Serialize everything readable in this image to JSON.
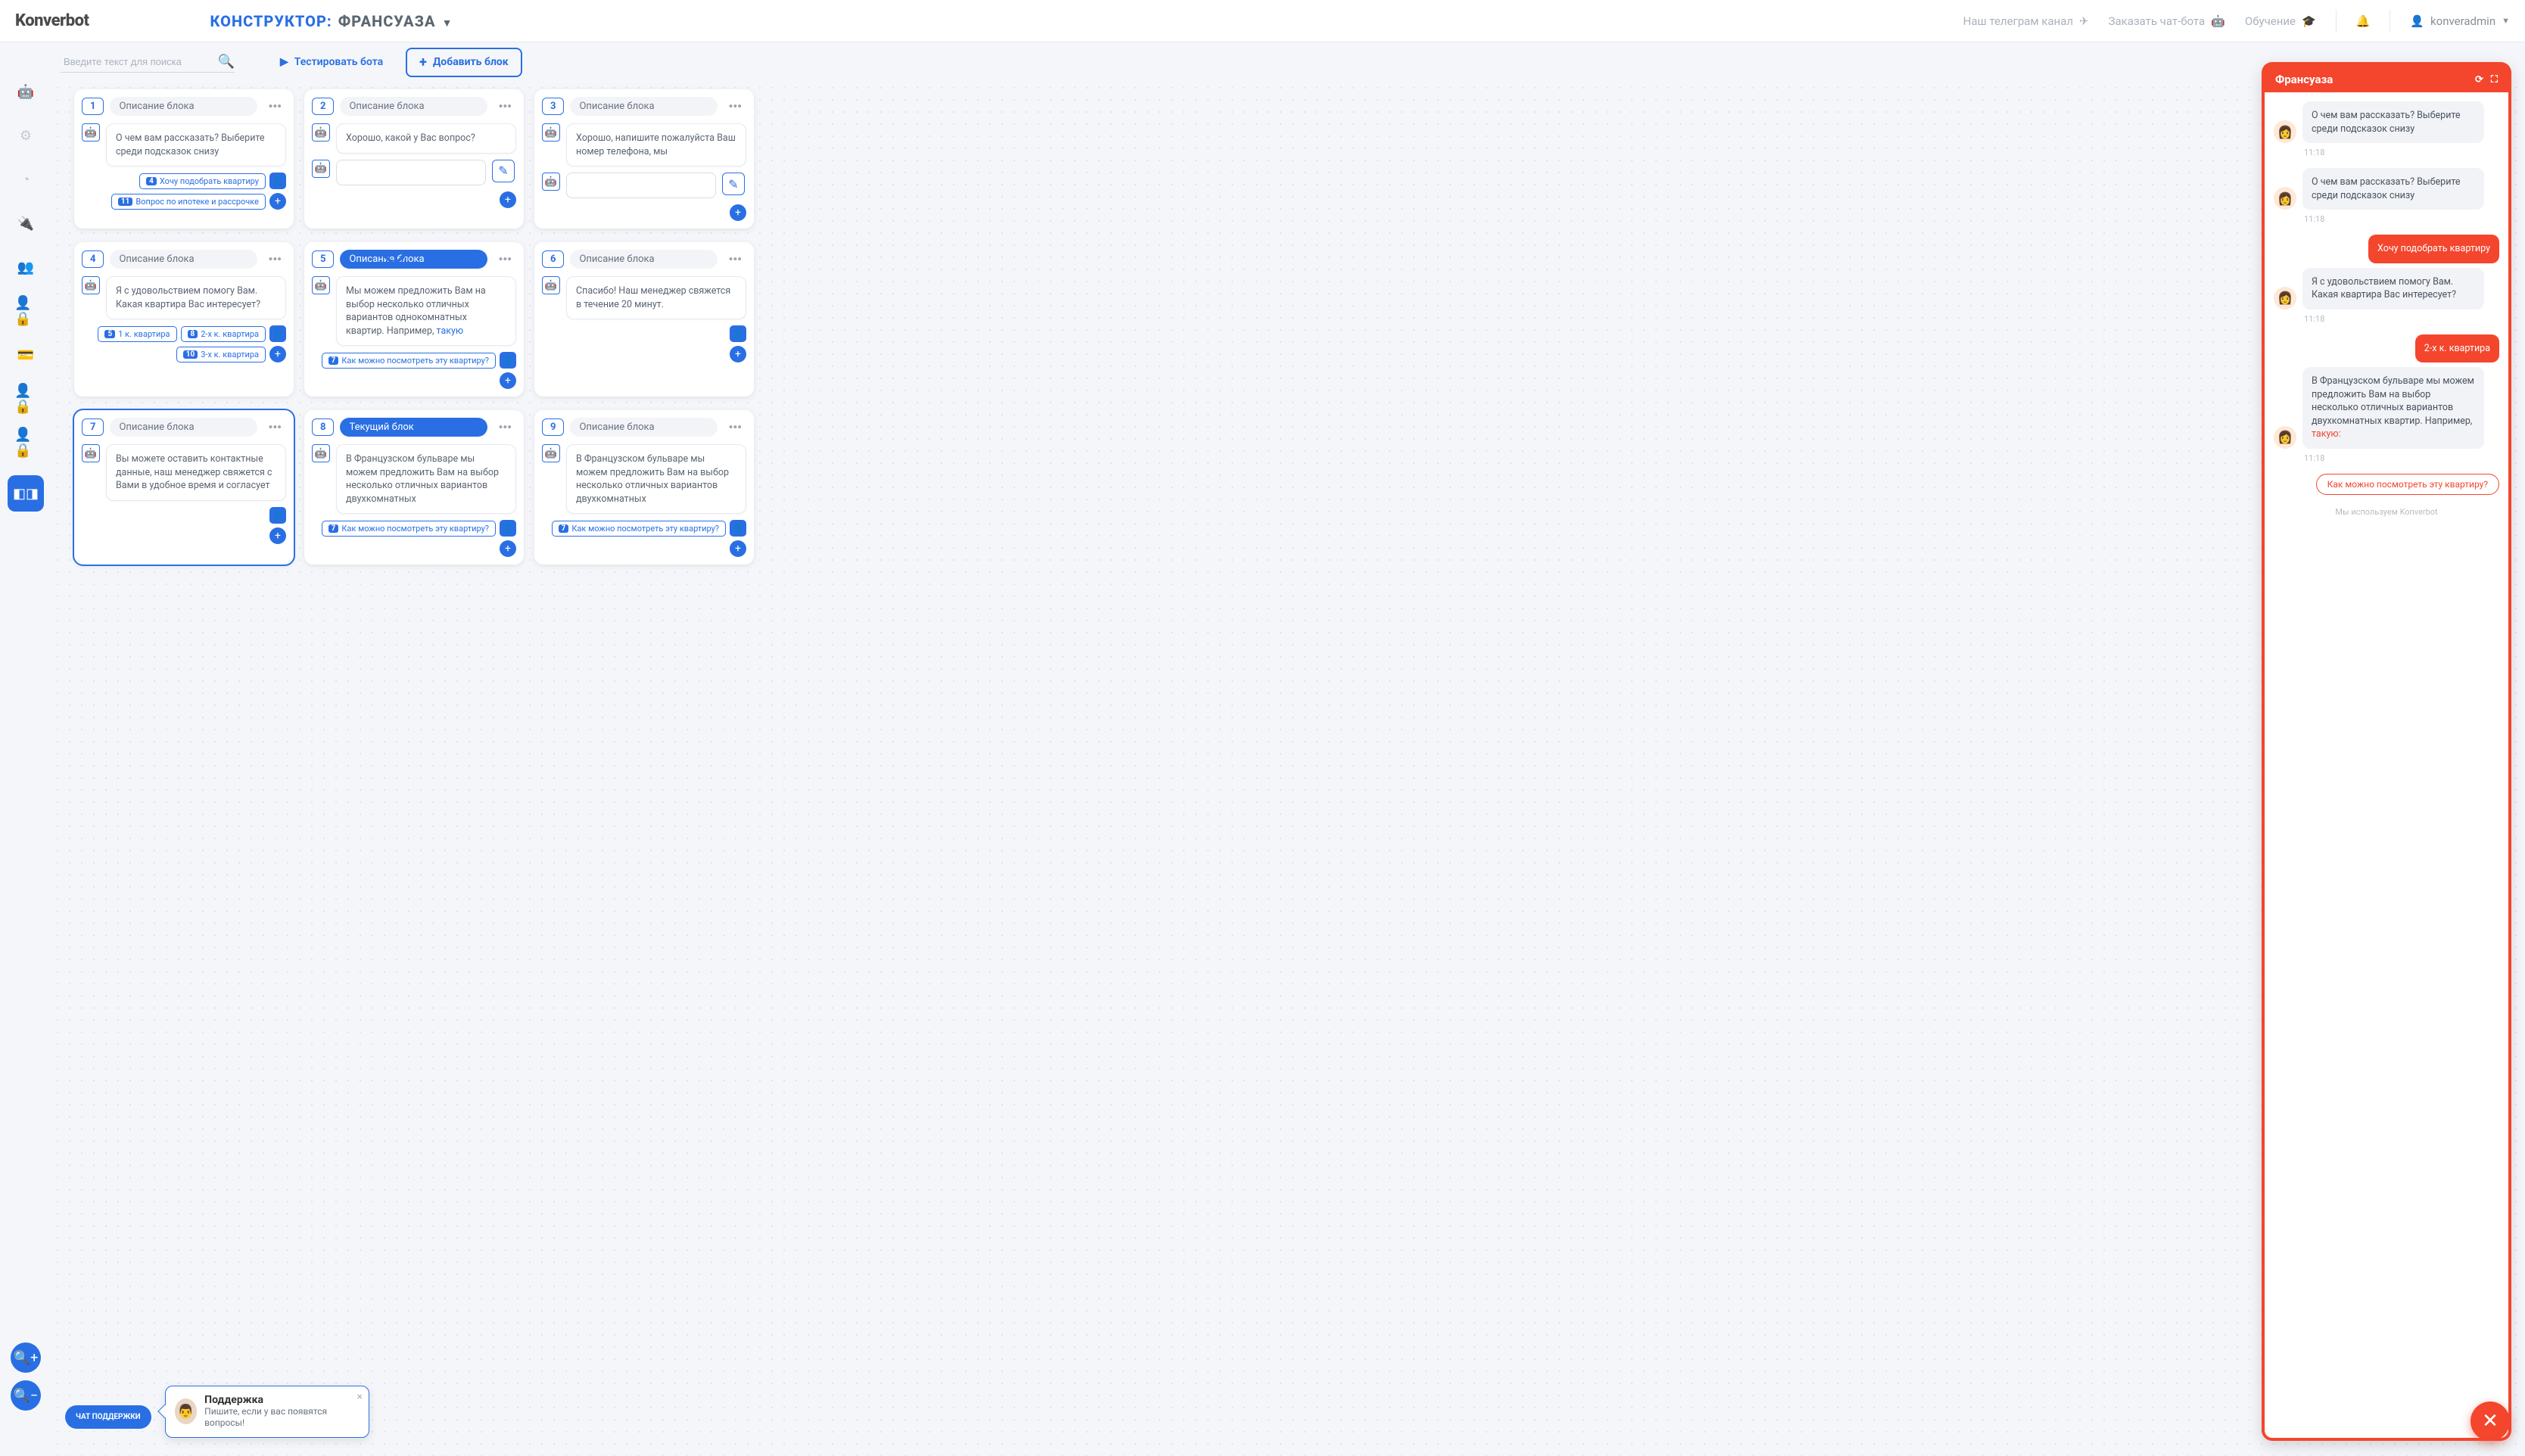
{
  "header": {
    "logo": "Konverbot",
    "constructor_label": "КОНСТРУКТОР:",
    "bot_name": "ФРАНСУАЗА",
    "links": {
      "telegram": "Наш телеграм канал",
      "order": "Заказать чат-бота",
      "learn": "Обучение"
    },
    "user": "konveradmin"
  },
  "toolbar": {
    "search_placeholder": "Введите текст для поиска",
    "test_label": "Тестировать бота",
    "add_label": "Добавить блок"
  },
  "blocks": [
    {
      "id": "1",
      "title": "Описание блока",
      "message": "О чем вам рассказать? Выберите среди подсказок снизу",
      "chips": [
        {
          "n": "4",
          "t": "Хочу подобрать квартиру"
        },
        {
          "n": "11",
          "t": "Вопрос по ипотеке и рассрочке"
        }
      ]
    },
    {
      "id": "2",
      "title": "Описание блока",
      "message": "Хорошо, какой у Вас вопрос?",
      "has_input": true
    },
    {
      "id": "3",
      "title": "Описание блока",
      "message": "Хорошо, напишите пожалуйста Ваш номер телефона, мы",
      "has_input": true
    },
    {
      "id": "4",
      "title": "Описание блока",
      "message": "Я с удовольствием помогу Вам. Какая квартира Вас интересует?",
      "chips": [
        {
          "n": "5",
          "t": "1 к. квартира"
        },
        {
          "n": "8",
          "t": "2-х к. квартира"
        },
        {
          "n": "10",
          "t": "3-х к. квартира"
        }
      ],
      "chip_rows": 2
    },
    {
      "id": "5",
      "title": "Описание блока",
      "active": true,
      "message": "Мы можем предложить Вам на выбор несколько отличных вариантов однокомнатных квартир. Например, ",
      "link": "такую",
      "chips": [
        {
          "n": "7",
          "t": "Как можно посмотреть эту квартиру?"
        }
      ]
    },
    {
      "id": "6",
      "title": "Описание блока",
      "message": "Спасибо! Наш менеджер свяжется в течение 20 минут."
    },
    {
      "id": "7",
      "title": "Описание блока",
      "selected": true,
      "message": "Вы можете оставить контактные данные, наш менеджер свяжется с Вами в удобное время и согласует"
    },
    {
      "id": "8",
      "title": "Текущий блок",
      "current": true,
      "message": "В Французском бульваре мы можем предложить Вам на выбор несколько отличных вариантов двухкомнатных",
      "chips": [
        {
          "n": "7",
          "t": "Как можно посмотреть эту квартиру?"
        }
      ]
    },
    {
      "id": "9",
      "title": "Описание блока",
      "message": "В Французском бульваре мы можем предложить Вам на выбор несколько отличных вариантов двухкомнатных",
      "chips": [
        {
          "n": "7",
          "t": "Как можно посмотреть эту квартиру?"
        }
      ]
    }
  ],
  "preview": {
    "title": "Франсуаза",
    "messages": [
      {
        "who": "bot",
        "text": "О чем вам рассказать? Выберите среди подсказок снизу",
        "time": "11:18"
      },
      {
        "who": "bot",
        "text": "О чем вам рассказать? Выберите среди подсказок снизу",
        "time": "11:18"
      },
      {
        "who": "user",
        "text": "Хочу подобрать квартиру"
      },
      {
        "who": "bot",
        "text": "Я с удовольствием помогу Вам. Какая квартира Вас интересует?",
        "time": "11:18"
      },
      {
        "who": "user",
        "text": "2-х к. квартира"
      },
      {
        "who": "bot",
        "text": "В Французском бульваре мы можем предложить Вам на выбор несколько отличных вариантов двухкомнатных квартир. Например, ",
        "link": "такую:",
        "time": "11:18"
      }
    ],
    "suggestion": "Как можно посмотреть эту квартиру?",
    "footer": "Мы используем Konverbot"
  },
  "support": {
    "pill": "ЧАТ ПОДДЕРЖКИ",
    "title": "Поддержка",
    "text": "Пишите, если у вас появятся вопросы!"
  }
}
